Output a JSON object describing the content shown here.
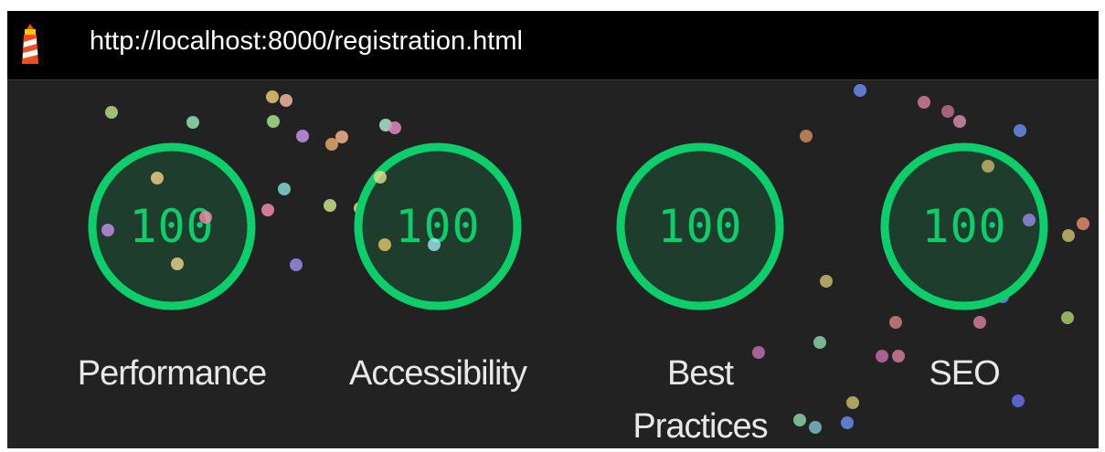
{
  "browser": {
    "url": "http://localhost:8000/registration.html",
    "icon": "lighthouse-icon"
  },
  "theme": {
    "background": "#222222",
    "topbar": "#000000",
    "pass_color": "#0cce6b",
    "pass_fill": "#1f3d2c",
    "label_color": "#e8e8e8"
  },
  "categories": [
    {
      "id": "performance",
      "label": "Performance",
      "score": "100",
      "value": 1.0
    },
    {
      "id": "accessibility",
      "label": "Accessibility",
      "score": "100",
      "value": 1.0
    },
    {
      "id": "best-practices",
      "label": "Best\nPractices",
      "score": "100",
      "value": 1.0
    },
    {
      "id": "seo",
      "label": "SEO",
      "score": "100",
      "value": 1.0
    }
  ]
}
